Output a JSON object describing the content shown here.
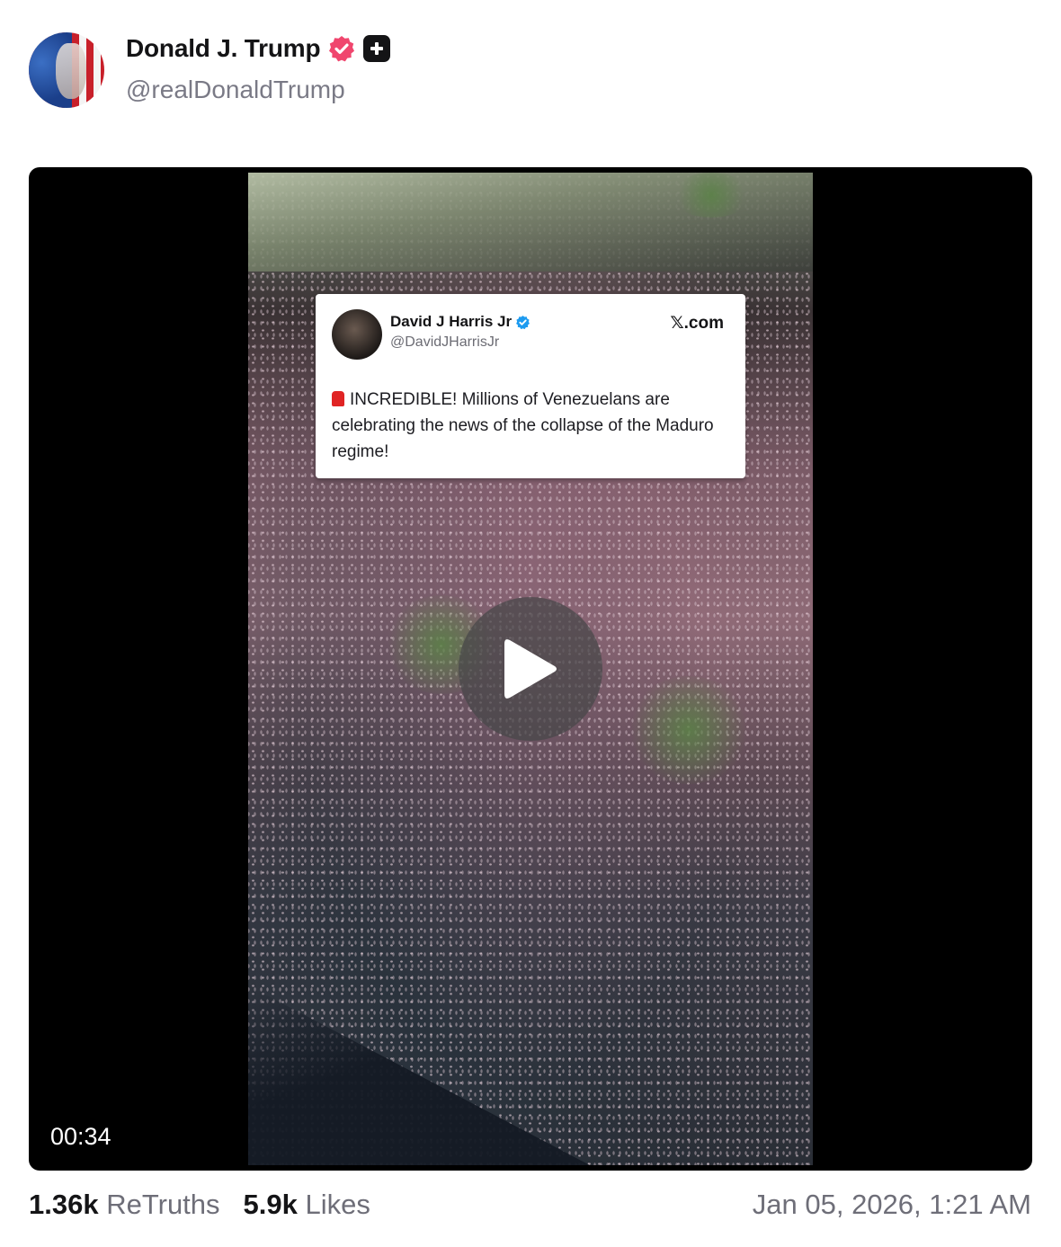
{
  "author": {
    "display_name": "Donald J. Trump",
    "handle": "@realDonaldTrump",
    "verified_badge_color": "#f0466e"
  },
  "media": {
    "type": "video",
    "duration": "00:34",
    "embedded_post": {
      "name": "David J Harris Jr",
      "handle": "@DavidJHarrisJr",
      "source": "𝕏.com",
      "text": "INCREDIBLE! Millions of Venezuelans are celebrating the news of the collapse of the Maduro regime!",
      "verified_badge_color": "#1d9bf0"
    }
  },
  "stats": {
    "retruths_count": "1.36k",
    "retruths_label": "ReTruths",
    "likes_count": "5.9k",
    "likes_label": "Likes"
  },
  "timestamp": "Jan 05, 2026, 1:21 AM"
}
